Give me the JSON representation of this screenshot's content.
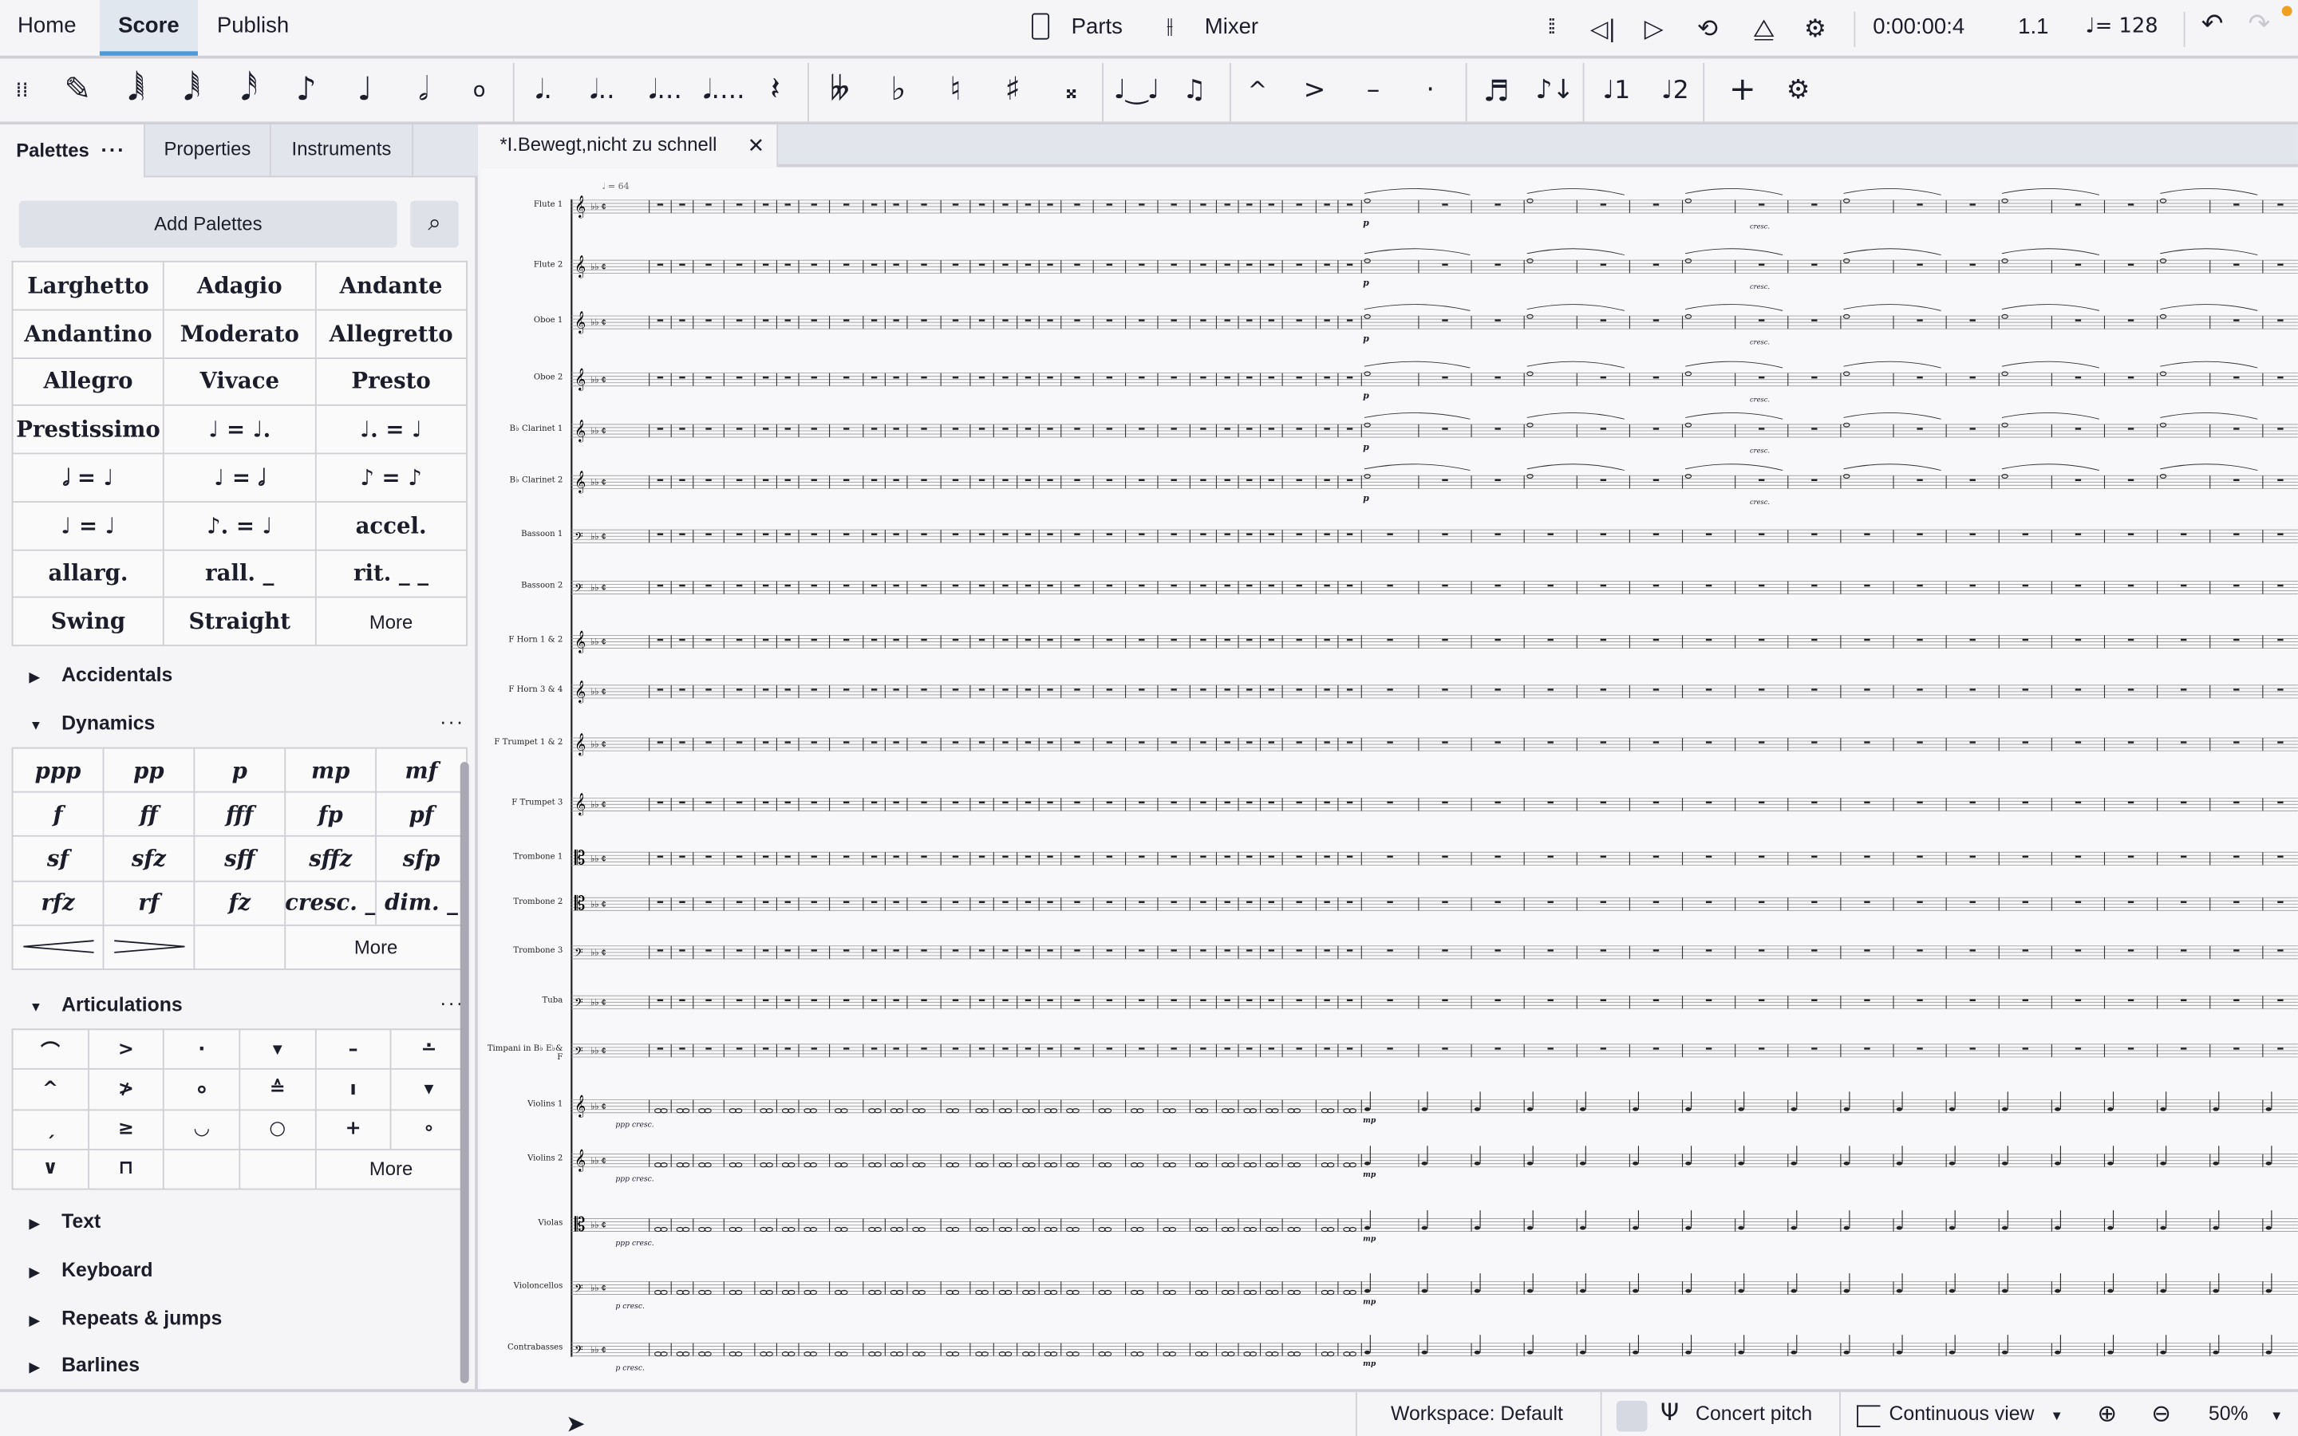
{
  "topbar": {
    "tabs": [
      "Home",
      "Score",
      "Publish"
    ],
    "active_tab": "Score",
    "parts_label": "Parts",
    "mixer_label": "Mixer",
    "time": "0:00:00:4",
    "position": "1.1",
    "tempo": "♩= 128",
    "accent_color": "#4c9ad8",
    "notification_color": "#f0a020"
  },
  "toolbar": {
    "note_input_icons": [
      "pencil-icon",
      "64th-note-icon",
      "32nd-note-icon",
      "16th-note-icon",
      "eighth-note-icon",
      "quarter-note-icon",
      "half-note-icon",
      "whole-note-icon"
    ],
    "dot_icons": [
      "𝅘𝅥.",
      "𝅘𝅥..",
      "𝅘𝅥...",
      "𝅘𝅥...."
    ],
    "accidental_glyphs": [
      "𝄫",
      "♭",
      "♮",
      "♯",
      "𝄪"
    ],
    "articulation_glyphs": [
      "^",
      ">",
      "–",
      "·"
    ],
    "voice_labels": [
      "1",
      "2"
    ]
  },
  "panel": {
    "tabs": [
      "Palettes",
      "Properties",
      "Instruments"
    ],
    "add_palettes": "Add Palettes",
    "tempo_items": [
      "Larghetto",
      "Adagio",
      "Andante",
      "Andantino",
      "Moderato",
      "Allegretto",
      "Allegro",
      "Vivace",
      "Presto",
      "Prestissimo",
      "♩ = ♩.",
      "♩. = ♩",
      "𝅗𝅥 = ♩",
      "♩ = 𝅗𝅥",
      "♪ = ♪",
      "♩ = ♩",
      "♪. = ♩",
      "accel.",
      "allarg.",
      "rall. _",
      "rit. _ _",
      "Swing",
      "Straight",
      "More"
    ],
    "accidentals": "Accidentals",
    "dynamics": "Dynamics",
    "dynamics_items": [
      "ppp",
      "pp",
      "p",
      "mp",
      "mf",
      "f",
      "ff",
      "fff",
      "fp",
      "pf",
      "sf",
      "sfz",
      "sff",
      "sffz",
      "sfp",
      "rfz",
      "rf",
      "fz",
      "cresc. _",
      "dim. _"
    ],
    "hairpins": [
      "<",
      ">"
    ],
    "dynamics_more": "More",
    "articulations": "Articulations",
    "articulation_items": [
      "⌒",
      ">",
      "·",
      "▾",
      "–",
      "∸",
      "^",
      "≯",
      "⸰",
      "≙",
      "ı",
      "▾",
      "ˏ",
      "≥",
      "◡",
      "○",
      "+",
      "∘",
      "∨",
      "⊓"
    ],
    "articulations_more": "More",
    "collapsed_sections": [
      "Text",
      "Keyboard",
      "Repeats & jumps",
      "Barlines"
    ]
  },
  "document": {
    "tab_title": "*I.Bewegt,nicht zu schnell",
    "tempo_mark": "𝅗𝅥 = 64",
    "instruments": [
      "Flute 1",
      "Flute 2",
      "Oboe 1",
      "Oboe 2",
      "B♭ Clarinet 1",
      "B♭ Clarinet 2",
      "Bassoon 1",
      "Bassoon 2",
      "F Horn 1 & 2",
      "F Horn 3 & 4",
      "F Trumpet 1 & 2",
      "F Trumpet 3",
      "Trombone 1",
      "Trombone 2",
      "Trombone 3",
      "Tuba",
      "Timpani in B♭ E♭& F",
      "Violins 1",
      "Violins 2",
      "Violas",
      "Violoncellos",
      "Contrabasses"
    ],
    "dynamic_marks": [
      "ppp cresc.",
      "p cresc.",
      "p",
      "cresc.",
      "mp"
    ]
  },
  "status": {
    "workspace": "Workspace: Default",
    "concert_pitch": "Concert pitch",
    "view_mode": "Continuous view",
    "zoom": "50%"
  }
}
